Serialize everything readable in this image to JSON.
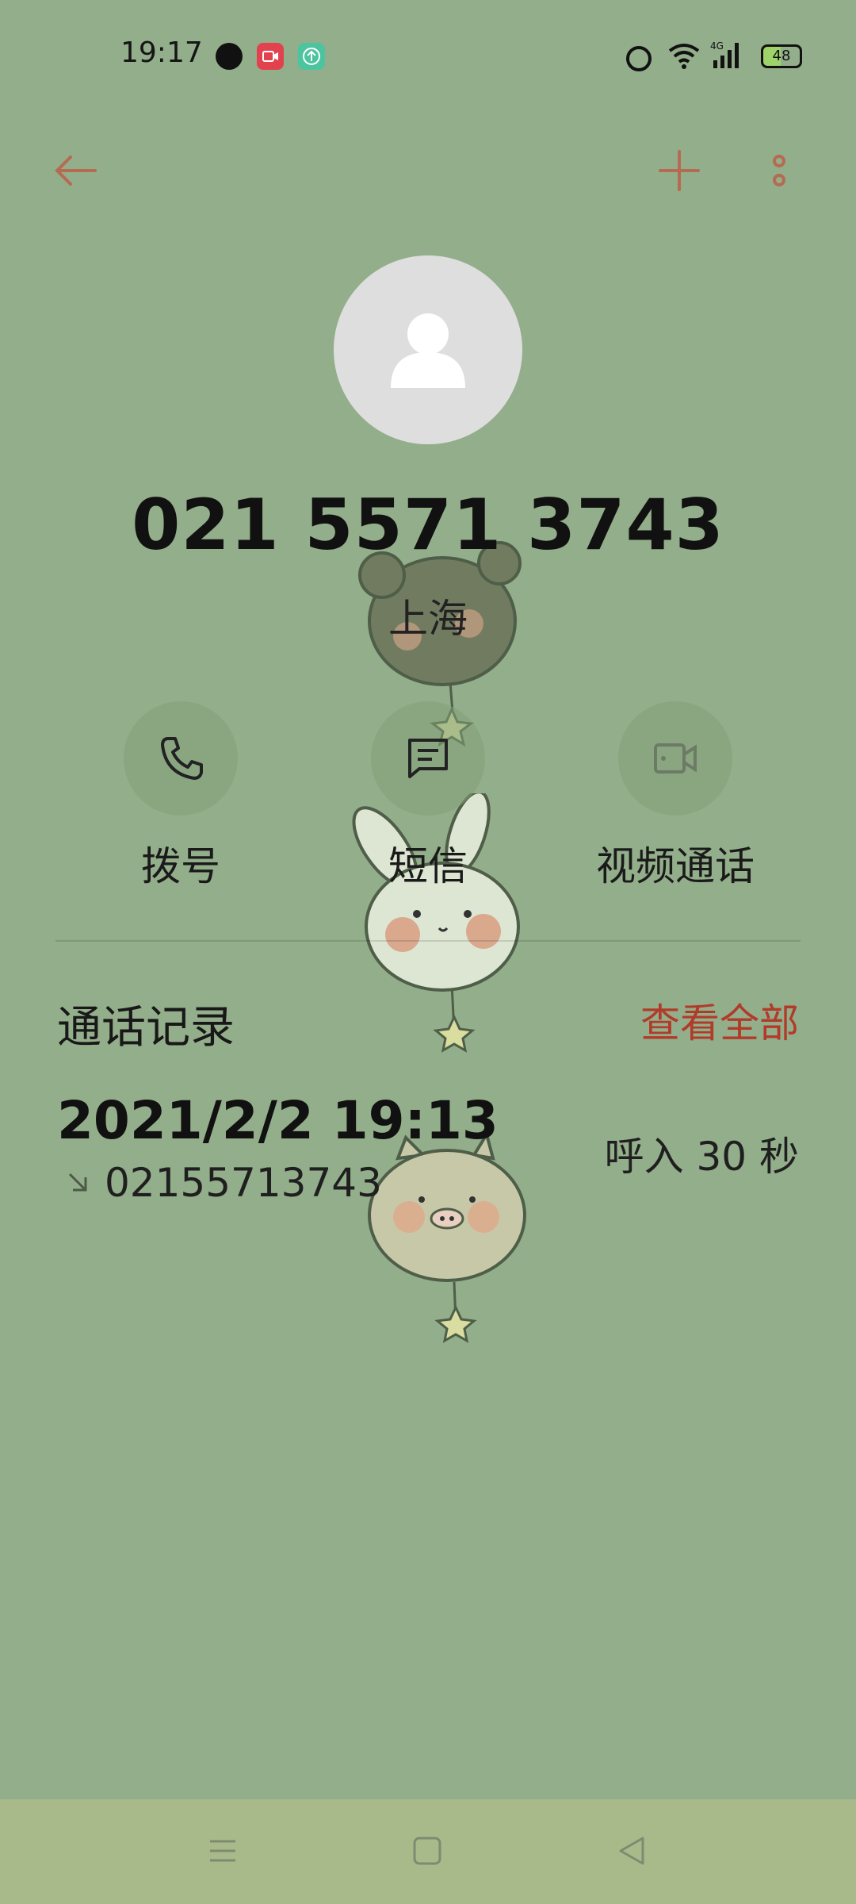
{
  "colors": {
    "background": "#93AE8A",
    "accent": "#B13B2A",
    "navbar": "#A9BA8A",
    "icon_tint": "#B56B52"
  },
  "status_bar": {
    "time": "19:17",
    "battery": "48",
    "icons": [
      "globe-icon",
      "screen-record-icon",
      "upload-icon",
      "alarm-icon",
      "wifi-icon",
      "signal-4g-icon",
      "battery-icon"
    ]
  },
  "toolbar": {
    "back_icon": "arrow-left-icon",
    "add_icon": "plus-icon",
    "more_icon": "more-vertical-icon"
  },
  "contact": {
    "avatar_icon": "person-icon",
    "number": "021 5571 3743",
    "location": "上海"
  },
  "actions": [
    {
      "label": "拨号",
      "icon": "phone-icon"
    },
    {
      "label": "短信",
      "icon": "message-icon"
    },
    {
      "label": "视频通话",
      "icon": "video-call-icon"
    }
  ],
  "call_log": {
    "title": "通话记录",
    "view_all": "查看全部",
    "entries": [
      {
        "datetime": "2021/2/2 19:13",
        "number": "02155713743",
        "direction_icon": "incoming-call-arrow-icon",
        "result": "呼入  30 秒"
      }
    ]
  },
  "nav": {
    "icons": [
      "menu-icon",
      "home-icon",
      "back-icon"
    ]
  }
}
